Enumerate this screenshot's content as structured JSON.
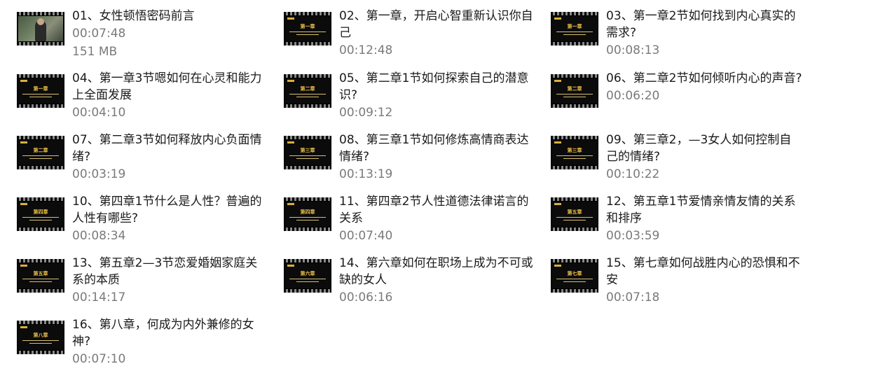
{
  "videos": [
    {
      "title": "01、女性顿悟密码前言",
      "duration": "00:07:48",
      "size": "151 MB",
      "thumb_type": "photo",
      "chapter_label": ""
    },
    {
      "title": "02、第一章，开启心智重新认识你自己",
      "duration": "00:12:48",
      "thumb_type": "slide",
      "chapter_label": "第一章"
    },
    {
      "title": "03、第一章2节如何找到内心真实的需求?",
      "duration": "00:08:13",
      "thumb_type": "slide",
      "chapter_label": "第一章"
    },
    {
      "title": "04、第一章3节嗯如何在心灵和能力上全面发展",
      "duration": "00:04:10",
      "thumb_type": "slide",
      "chapter_label": "第一章"
    },
    {
      "title": "05、第二章1节如何探索自己的潜意识?",
      "duration": "00:09:12",
      "thumb_type": "slide",
      "chapter_label": "第二章"
    },
    {
      "title": "06、第二章2节如何倾听内心的声音?",
      "duration": "00:06:20",
      "thumb_type": "slide",
      "chapter_label": "第二章"
    },
    {
      "title": "07、第二章3节如何释放内心负面情绪?",
      "duration": "00:03:19",
      "thumb_type": "slide",
      "chapter_label": "第二章"
    },
    {
      "title": "08、第三章1节如何修炼高情商表达情绪?",
      "duration": "00:13:19",
      "thumb_type": "slide",
      "chapter_label": "第三章"
    },
    {
      "title": "09、第三章2，—3女人如何控制自己的情绪?",
      "duration": "00:10:22",
      "thumb_type": "slide",
      "chapter_label": "第三章"
    },
    {
      "title": "10、第四章1节什么是人性？普遍的人性有哪些?",
      "duration": "00:08:34",
      "thumb_type": "slide",
      "chapter_label": "第四章"
    },
    {
      "title": "11、第四章2节人性道德法律诺言的关系",
      "duration": "00:07:40",
      "thumb_type": "slide",
      "chapter_label": "第四章"
    },
    {
      "title": "12、第五章1节爱情亲情友情的关系和排序",
      "duration": "00:03:59",
      "thumb_type": "slide",
      "chapter_label": "第五章"
    },
    {
      "title": "13、第五章2—3节恋爱婚姻家庭关系的本质",
      "duration": "00:14:17",
      "thumb_type": "slide",
      "chapter_label": "第五章"
    },
    {
      "title": "14、第六章如何在职场上成为不可或缺的女人",
      "duration": "00:06:16",
      "thumb_type": "slide",
      "chapter_label": "第六章"
    },
    {
      "title": "15、第七章如何战胜内心的恐惧和不安",
      "duration": "00:07:18",
      "thumb_type": "slide",
      "chapter_label": "第七章"
    },
    {
      "title": "16、第八章，何成为内外兼修的女神?",
      "duration": "00:07:10",
      "thumb_type": "slide",
      "chapter_label": "第八章"
    }
  ]
}
